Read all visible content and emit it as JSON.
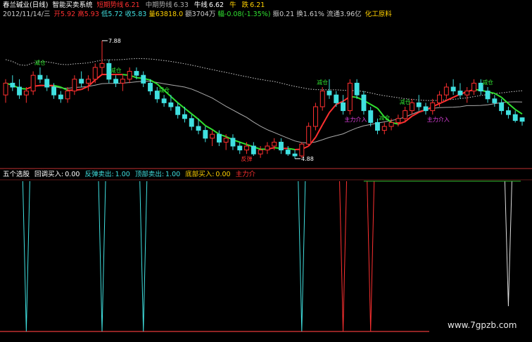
{
  "header": {
    "title": "春兰碱业(日线)",
    "system": "智能买卖系统",
    "items": [
      {
        "label": "短期势线",
        "value": "6.21",
        "color": "#ff3030"
      },
      {
        "label": "中期势线",
        "value": "6.33",
        "color": "#aaaaaa"
      },
      {
        "label": "牛线",
        "value": "6.62",
        "color": "#ffffff"
      },
      {
        "label": "牛",
        "value": "",
        "color": "#ffd000"
      },
      {
        "label": "跌",
        "value": "6.21",
        "color": "#ffd000"
      }
    ],
    "quote": {
      "date": "2012/11/14/三",
      "open_label": "开",
      "open": "5.92",
      "high_label": "高",
      "high": "5.93",
      "low_label": "低",
      "low": "5.72",
      "close_label": "收",
      "close": "5.83",
      "volume_label": "量",
      "volume": "63818.0",
      "amount_label": "额",
      "amount": "3704万",
      "change_label": "幅",
      "change": "-0.08(-1.35%)",
      "amplitude_label": "振",
      "amplitude": "0.21",
      "turnover_label": "换",
      "turnover": "1.61%",
      "float_label": "流通",
      "float": "3.96亿",
      "sector": "化工原料"
    }
  },
  "indicator": {
    "name": "五个选股",
    "items": [
      {
        "label": "回调买入:",
        "value": "0.00",
        "color": "#ffffff"
      },
      {
        "label": "反弹卖出:",
        "value": "1.00",
        "color": "#40e0e0"
      },
      {
        "label": "顶部卖出:",
        "value": "1.00",
        "color": "#40e0e0"
      },
      {
        "label": "底部买入:",
        "value": "0.00",
        "color": "#ffd000"
      },
      {
        "label": "主力介",
        "value": "",
        "color": "#ff3030"
      }
    ]
  },
  "annotations": {
    "high_price": "7.88",
    "low_price": "4.88",
    "signals": [
      "减仓",
      "减仓",
      "减仓",
      "反弹",
      "减仓",
      "主力介入",
      "减仓",
      "减仓",
      "主力介入",
      "减仓"
    ]
  },
  "chart_data": [
    {
      "type": "candlestick",
      "colors": {
        "up": "#ff3030",
        "down": "#40e0e0",
        "short_line_up": "#ff3030",
        "short_line_down": "#30e030",
        "mid_line": "#aaaaaa",
        "long_line": "#cccccc"
      },
      "price_range": [
        4.7,
        8.2
      ],
      "candles": [
        [
          6.5,
          6.9,
          6.3,
          6.8
        ],
        [
          6.8,
          7.0,
          6.6,
          6.7
        ],
        [
          6.7,
          6.9,
          6.4,
          6.5
        ],
        [
          6.5,
          6.7,
          6.3,
          6.6
        ],
        [
          6.6,
          7.1,
          6.5,
          7.0
        ],
        [
          7.0,
          7.2,
          6.8,
          6.9
        ],
        [
          6.9,
          7.0,
          6.6,
          6.7
        ],
        [
          6.7,
          6.8,
          6.4,
          6.5
        ],
        [
          6.5,
          6.6,
          6.3,
          6.4
        ],
        [
          6.4,
          6.7,
          6.3,
          6.6
        ],
        [
          6.6,
          7.0,
          6.5,
          6.9
        ],
        [
          6.9,
          7.1,
          6.7,
          6.8
        ],
        [
          6.8,
          7.0,
          6.6,
          6.9
        ],
        [
          6.9,
          7.3,
          6.8,
          7.2
        ],
        [
          7.2,
          7.88,
          7.0,
          7.3
        ],
        [
          7.3,
          7.4,
          6.8,
          6.9
        ],
        [
          6.9,
          7.0,
          6.7,
          6.8
        ],
        [
          6.8,
          7.0,
          6.6,
          6.9
        ],
        [
          6.9,
          7.2,
          6.8,
          7.1
        ],
        [
          7.1,
          7.2,
          6.9,
          7.0
        ],
        [
          7.0,
          7.1,
          6.7,
          6.8
        ],
        [
          6.8,
          6.9,
          6.5,
          6.6
        ],
        [
          6.6,
          6.7,
          6.3,
          6.4
        ],
        [
          6.4,
          6.5,
          6.2,
          6.3
        ],
        [
          6.3,
          6.5,
          6.1,
          6.2
        ],
        [
          6.2,
          6.3,
          5.9,
          6.0
        ],
        [
          6.0,
          6.2,
          5.8,
          5.9
        ],
        [
          5.9,
          6.0,
          5.6,
          5.7
        ],
        [
          5.7,
          5.9,
          5.5,
          5.6
        ],
        [
          5.6,
          5.7,
          5.3,
          5.4
        ],
        [
          5.4,
          5.6,
          5.2,
          5.5
        ],
        [
          5.5,
          5.6,
          5.2,
          5.3
        ],
        [
          5.3,
          5.5,
          5.1,
          5.4
        ],
        [
          5.4,
          5.5,
          5.1,
          5.2
        ],
        [
          5.2,
          5.3,
          5.0,
          5.1
        ],
        [
          5.1,
          5.3,
          5.0,
          5.2
        ],
        [
          5.2,
          5.3,
          4.95,
          5.0
        ],
        [
          5.0,
          5.2,
          4.9,
          5.1
        ],
        [
          5.1,
          5.3,
          5.0,
          5.2
        ],
        [
          5.2,
          5.4,
          5.1,
          5.3
        ],
        [
          5.3,
          5.4,
          5.0,
          5.1
        ],
        [
          5.1,
          5.2,
          4.95,
          5.0
        ],
        [
          5.0,
          5.1,
          4.88,
          4.95
        ],
        [
          4.95,
          5.3,
          4.9,
          5.25
        ],
        [
          5.25,
          5.8,
          5.2,
          5.7
        ],
        [
          5.7,
          6.3,
          5.6,
          6.2
        ],
        [
          6.2,
          6.7,
          6.1,
          6.6
        ],
        [
          6.6,
          6.9,
          6.4,
          6.5
        ],
        [
          6.5,
          6.6,
          6.2,
          6.3
        ],
        [
          6.3,
          6.5,
          6.0,
          6.1
        ],
        [
          6.1,
          6.9,
          6.0,
          6.8
        ],
        [
          6.8,
          6.9,
          6.4,
          6.5
        ],
        [
          6.5,
          6.6,
          6.0,
          6.1
        ],
        [
          6.1,
          6.2,
          5.7,
          5.8
        ],
        [
          5.8,
          5.9,
          5.5,
          5.6
        ],
        [
          5.6,
          5.8,
          5.5,
          5.7
        ],
        [
          5.7,
          5.9,
          5.6,
          5.8
        ],
        [
          5.8,
          6.0,
          5.7,
          5.9
        ],
        [
          5.9,
          6.2,
          5.8,
          6.1
        ],
        [
          6.1,
          6.4,
          6.0,
          6.3
        ],
        [
          6.3,
          6.5,
          6.1,
          6.2
        ],
        [
          6.2,
          6.3,
          6.0,
          6.1
        ],
        [
          6.1,
          6.4,
          6.0,
          6.3
        ],
        [
          6.3,
          6.6,
          6.2,
          6.5
        ],
        [
          6.5,
          6.8,
          6.4,
          6.7
        ],
        [
          6.7,
          6.9,
          6.5,
          6.6
        ],
        [
          6.6,
          6.8,
          6.4,
          6.5
        ],
        [
          6.5,
          6.7,
          6.3,
          6.6
        ],
        [
          6.6,
          6.9,
          6.5,
          6.8
        ],
        [
          6.8,
          6.9,
          6.5,
          6.6
        ],
        [
          6.6,
          6.7,
          6.3,
          6.4
        ],
        [
          6.4,
          6.5,
          6.2,
          6.3
        ],
        [
          6.3,
          6.4,
          6.0,
          6.1
        ],
        [
          6.1,
          6.2,
          5.9,
          6.0
        ],
        [
          6.0,
          6.1,
          5.8,
          5.85
        ],
        [
          5.92,
          5.93,
          5.72,
          5.83
        ]
      ]
    },
    {
      "type": "signal_lines",
      "y_range": [
        0,
        1
      ],
      "signals": [
        {
          "name": "反弹卖出",
          "color": "#40e0e0",
          "x": [
            3,
            14,
            20,
            43
          ]
        },
        {
          "name": "主力介入",
          "color": "#ff3030",
          "x": [
            49,
            53
          ]
        },
        {
          "name": "回调买入",
          "color": "#dddddd",
          "x": [
            73
          ]
        }
      ]
    }
  ],
  "watermark": "www.7gpzb.com"
}
